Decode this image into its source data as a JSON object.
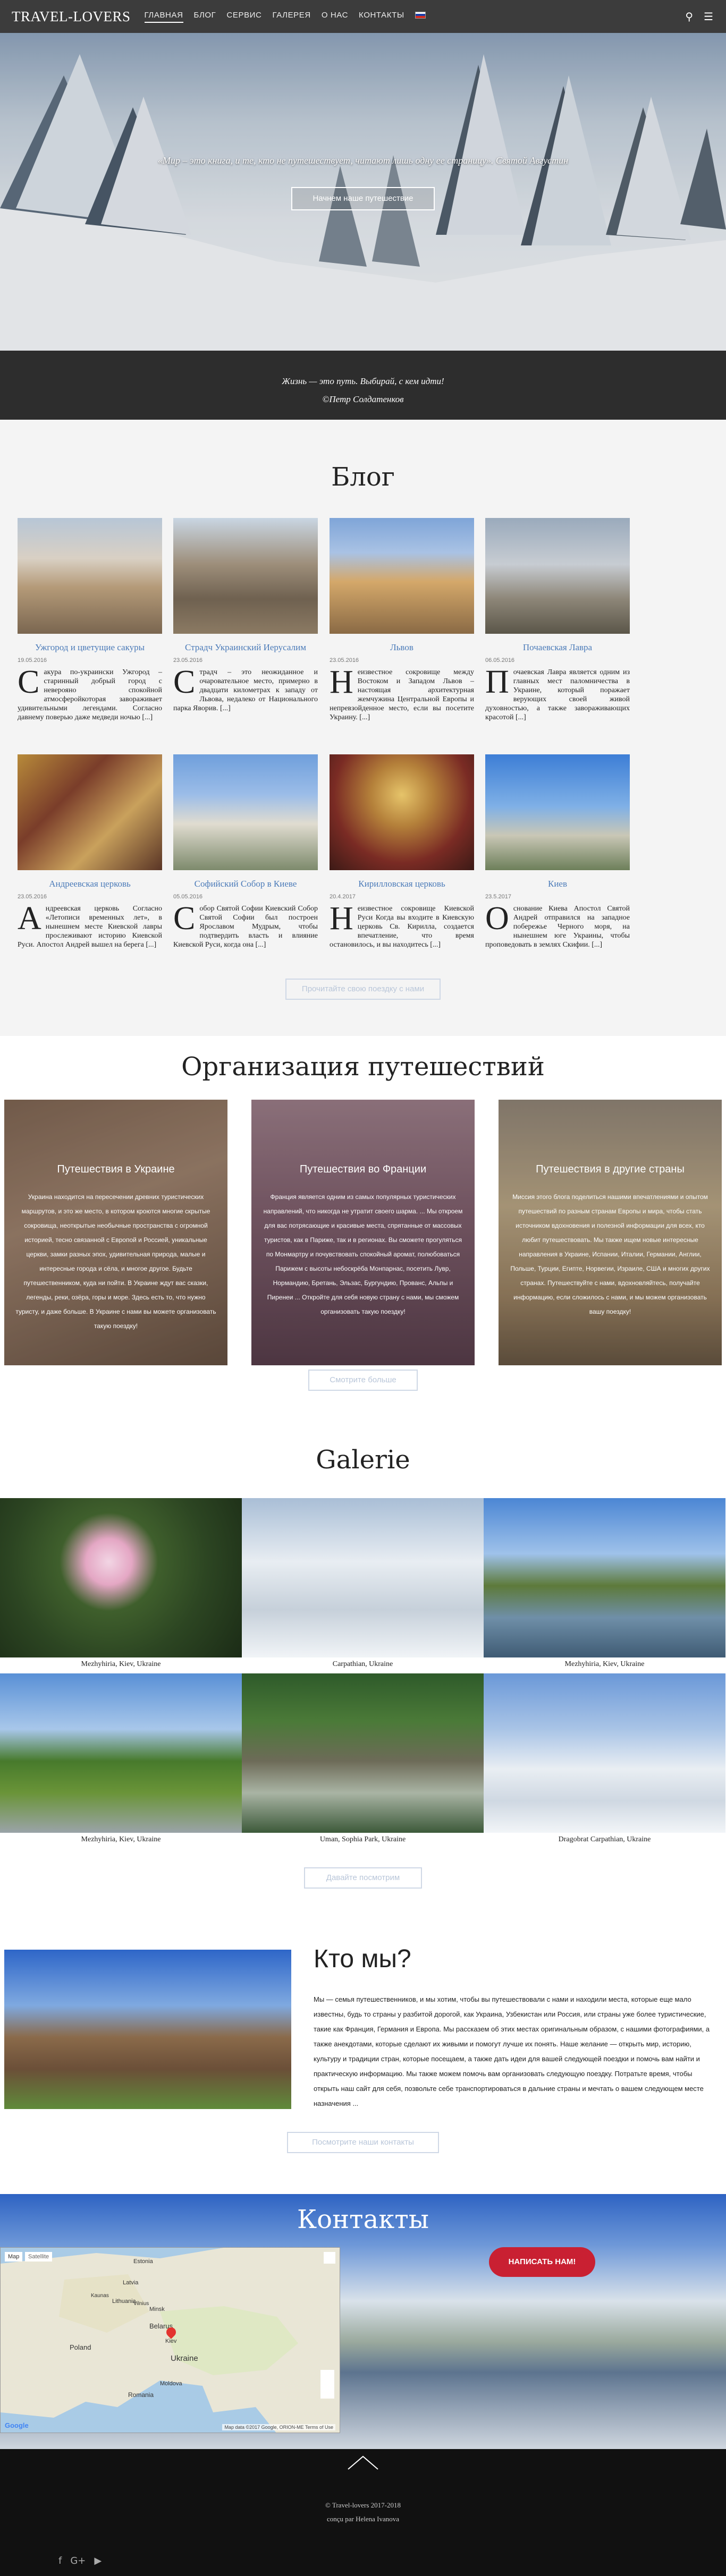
{
  "nav": {
    "logo": "TRAVEL-LOVERS",
    "items": [
      "ГЛАВНАЯ",
      "БЛОГ",
      "СЕРВИС",
      "ГАЛЕРЕЯ",
      "О НАС",
      "КОНТАКТЫ"
    ],
    "active_index": 0,
    "search_icon": "search-icon",
    "menu_icon": "hamburger-menu-icon"
  },
  "hero": {
    "quote": "«Мир – это книга, и те, кто не путешествует, читают лишь одну ее страницу». Святой Августин",
    "button": "Начнем наше путешествие"
  },
  "band": {
    "quote": "Жизнь — это путь. Выбирай, с кем идти!",
    "author": "©Петр Солдатенков"
  },
  "blog": {
    "title": "Блог",
    "posts": [
      {
        "title": "Ужгород и цветущие сакуры",
        "date": "19.05.2016",
        "initial": "С",
        "text": "акура по-украински Ужгород – старинный добрый город с неверояно спокойной атмосферойкоторая завораживает удивительными легендами. Согласно давнему поверью даже медведи ночью [...]"
      },
      {
        "title": "Страдч Украинский Иерусалим",
        "date": "23.05.2016",
        "initial": "С",
        "text": "традч – это неожиданное и очаровательное место, примерно в двадцати километрах к западу от Львова, недалеко от Национального парка Яворив. [...]"
      },
      {
        "title": "Львов",
        "date": "23.05.2016",
        "initial": "Н",
        "text": "еизвестное сокровище между Востоком и Западом Львов – настоящая архитектурная жемчужина Центральной Европы и непревзойденное место, если вы посетите Украину. [...]"
      },
      {
        "title": "Почаевская Лавра",
        "date": "06.05.2016",
        "initial": "П",
        "text": "очаевская Лавра является одним из главных мест паломничества в Украине, который поражает верующих своей живой духовностью, а также завораживающих красотой [...]"
      },
      {
        "title": "Андреевская церковь",
        "date": "23.05.2016",
        "initial": "А",
        "text": "ндреевская церковь Согласно «Летописи временных лет», в нынешнем месте Киевской лавры прослеживают историю Киевской Руси. Апостол Андрей вышел на берега [...]"
      },
      {
        "title": "Софийский Собор в Киеве",
        "date": "05.05.2016",
        "initial": "С",
        "text": "обор Святой Софии Киевский Собор Святой Софии был построен Ярославом Мудрым, чтобы подтвердить власть и влияние Киевской Руси, когда она [...]"
      },
      {
        "title": "Кирилловская церковь",
        "date": "20.4.2017",
        "initial": "Н",
        "text": "еизвестное сокровище Киевской Руси Когда вы входите в Киевскую церковь Св. Кирилла, создается впечатление, что время остановилось, и вы находитесь [...]"
      },
      {
        "title": "Киев",
        "date": "23.5.2017",
        "initial": "О",
        "text": "снование Киева Апостол Святой Андрей отправился на западное побережье Черного моря, на нынешнем юге Украины, чтобы проповедовать в землях Скифии. [...]"
      }
    ],
    "button": "Прочитайте свою поездку с нами"
  },
  "travel": {
    "title": "Организация путешествий",
    "cards": [
      {
        "title": "Путешествия в Украине",
        "text": "Украина находится на пересечении древних туристических маршрутов, и это же место, в котором кроются многие скрытые сокровища, неоткрытые необычные пространства с огромной историей, тесно связанной с Европой и Россией, уникальные церкви, замки разных эпох, удивительная природа, малые и интересные города и сёла, и многое другое. Будьте путешественником, куда ни пойти. В Украине ждут вас сказки, легенды, реки, озёра, горы и море. Здесь есть то, что нужно туристу, и даже больше. В Украине с нами вы можете организовать такую поездку!"
      },
      {
        "title": "Путешествия во Франции",
        "text": "Франция является одним из самых популярных туристических направлений, что никогда не утратит своего шарма. ... Мы откроем для вас потрясающие и красивые места, спрятанные от массовых туристов, как в Париже, так и в регионах. Вы сможете прогуляться по Монмартру и почувствовать спокойный аромат, полюбоваться Парижем с высоты небоскрёба Монпарнас, посетить Лувр, Нормандию, Бретань, Эльзас, Бургундию, Прованс, Альпы и Пиренеи ... Откройте для себя новую страну с нами, мы сможем организовать такую поездку!"
      },
      {
        "title": "Путешествия в другие страны",
        "text": "Миссия этого блога поделиться нашими впечатлениями и опытом путешествий по разным странам Европы и мира, чтобы стать источником вдохновения и полезной информации для всех, кто любит путешествовать. Мы также ищем новые интересные направления в Украине, Испании, Италии, Германии, Англии, Польше, Турции, Египте, Норвегии, Израиле, США и многих других странах. Путешествуйте с нами, вдохновляйтесь, получайте информацию, если сложилось с нами, и мы можем организовать вашу поездку!"
      }
    ],
    "button": "Смотрите больше"
  },
  "gallery": {
    "title": "Galerie",
    "items": [
      {
        "caption": "Mezhyhiria, Kiev, Ukraine"
      },
      {
        "caption": "Carpathian, Ukraine"
      },
      {
        "caption": "Mezhyhiria, Kiev, Ukraine"
      },
      {
        "caption": "Mezhyhiria, Kiev, Ukraine"
      },
      {
        "caption": "Uman, Sophia Park, Ukraine"
      },
      {
        "caption": "Dragobrat Carpathian, Ukraine"
      }
    ],
    "button": "Давайте посмотрим"
  },
  "about": {
    "title": "Кто мы?",
    "text": "Мы — семья путешественников, и мы хотим, чтобы вы путешествовали с нами и находили места, которые еще мало известны, будь то страны у разбитой дорогой, как Украина, Узбекистан или Россия, или страны уже более туристические, такие как Франция, Германия и Европа. Мы рассказем об этих местах оригинальным образом, с нашими фотографиями, а также анекдотами, которые сделают их живыми и помогут лучше их понять. Наше желание — открыть мир, историю, культуру и традиции стран, которые посещаем, а также дать идеи для вашей следующей поездки и помочь вам найти и практическую информацию. Мы также можем помочь вам организовать следующую поездку. Потратьте время, чтобы открыть наш сайт для себя, позвольте себе транспортироваться в дальние страны и мечтать о вашем следующем месте назначения ...",
    "button": "Посмотрите наши контакты"
  },
  "contacts": {
    "title": "Контакты",
    "map_tab_map": "Map",
    "map_tab_sat": "Satellite",
    "map_labels": [
      "Estonia",
      "Latvia",
      "Lithuania",
      "Belarus",
      "Poland",
      "Ukraine",
      "Romania",
      "Moldova",
      "Kiev",
      "Minsk",
      "Kaunas",
      "Vilnius"
    ],
    "map_footer": "Google",
    "map_terms": "Map data ©2017 Google, ORION-ME  Terms of Use",
    "write_button": "НАПИСАТЬ НАМ!"
  },
  "footer": {
    "up_icon": "chevron-up-icon",
    "copyright": "© Travel-lovers 2017-2018",
    "developer": "сonçu par Helena Ivanova",
    "social": [
      "facebook-icon",
      "google-plus-icon",
      "youtube-icon"
    ],
    "social_glyphs": [
      "f",
      "G+",
      "▶"
    ]
  },
  "colors": {
    "nav_bg": "#3c3c3c",
    "accent_link": "#4a7ab8",
    "write_button": "#c92032",
    "footer_bg": "#111111"
  }
}
